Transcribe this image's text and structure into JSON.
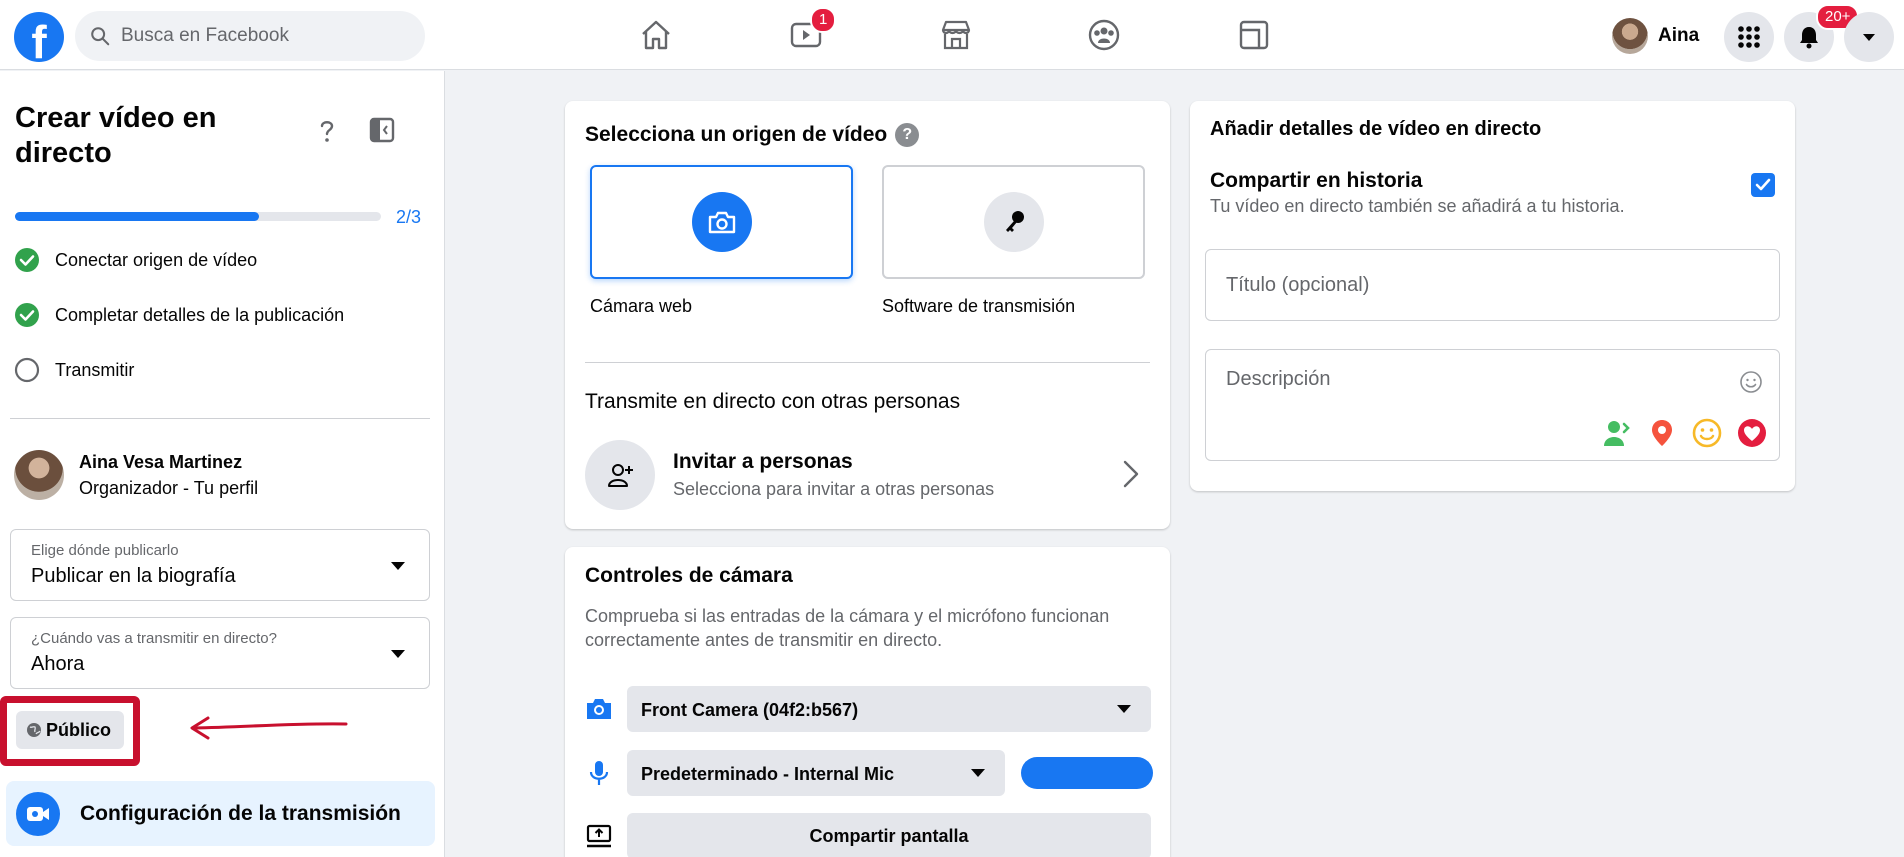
{
  "topbar": {
    "logo_letter": "f",
    "search_placeholder": "Busca en Facebook",
    "watch_badge": "1",
    "profile_name": "Aina",
    "notif_badge": "20+"
  },
  "left": {
    "title": "Crear vídeo en directo",
    "progress": {
      "label": "2/3",
      "fraction": 0.667
    },
    "steps": [
      {
        "label": "Conectar origen de vídeo",
        "done": true
      },
      {
        "label": "Completar detalles de la publicación",
        "done": true
      },
      {
        "label": "Transmitir",
        "done": false
      }
    ],
    "host": {
      "name": "Aina Vesa Martinez",
      "role": "Organizador - Tu perfil"
    },
    "where": {
      "label": "Elige dónde publicarlo",
      "value": "Publicar en la biografía"
    },
    "when": {
      "label": "¿Cuándo vas a transmitir en directo?",
      "value": "Ahora"
    },
    "audience_label": "Público",
    "config_label": "Configuración de la transmisión"
  },
  "source": {
    "title": "Selecciona un origen de vídeo",
    "help": "?",
    "options": [
      {
        "label": "Cámara web",
        "selected": true
      },
      {
        "label": "Software de transmisión",
        "selected": false
      }
    ],
    "with_others_title": "Transmite en directo con otras personas",
    "invite_title": "Invitar a personas",
    "invite_sub": "Selecciona para invitar a otras personas"
  },
  "camera": {
    "title": "Controles de cámara",
    "desc": "Comprueba si las entradas de la cámara y el micrófono funcionan correctamente antes de transmitir en directo.",
    "camera_device": "Front Camera (04f2:b567)",
    "mic_device": "Predeterminado - Internal Mic",
    "share_screen": "Compartir pantalla"
  },
  "details": {
    "title": "Añadir detalles de vídeo en directo",
    "story_title": "Compartir en historia",
    "story_sub": "Tu vídeo en directo también se añadirá a tu historia.",
    "story_checked": true,
    "title_placeholder": "Título (opcional)",
    "desc_placeholder": "Descripción"
  },
  "colors": {
    "accent": "#1877f2",
    "success": "#31a24c",
    "annotation": "#c8102e"
  }
}
